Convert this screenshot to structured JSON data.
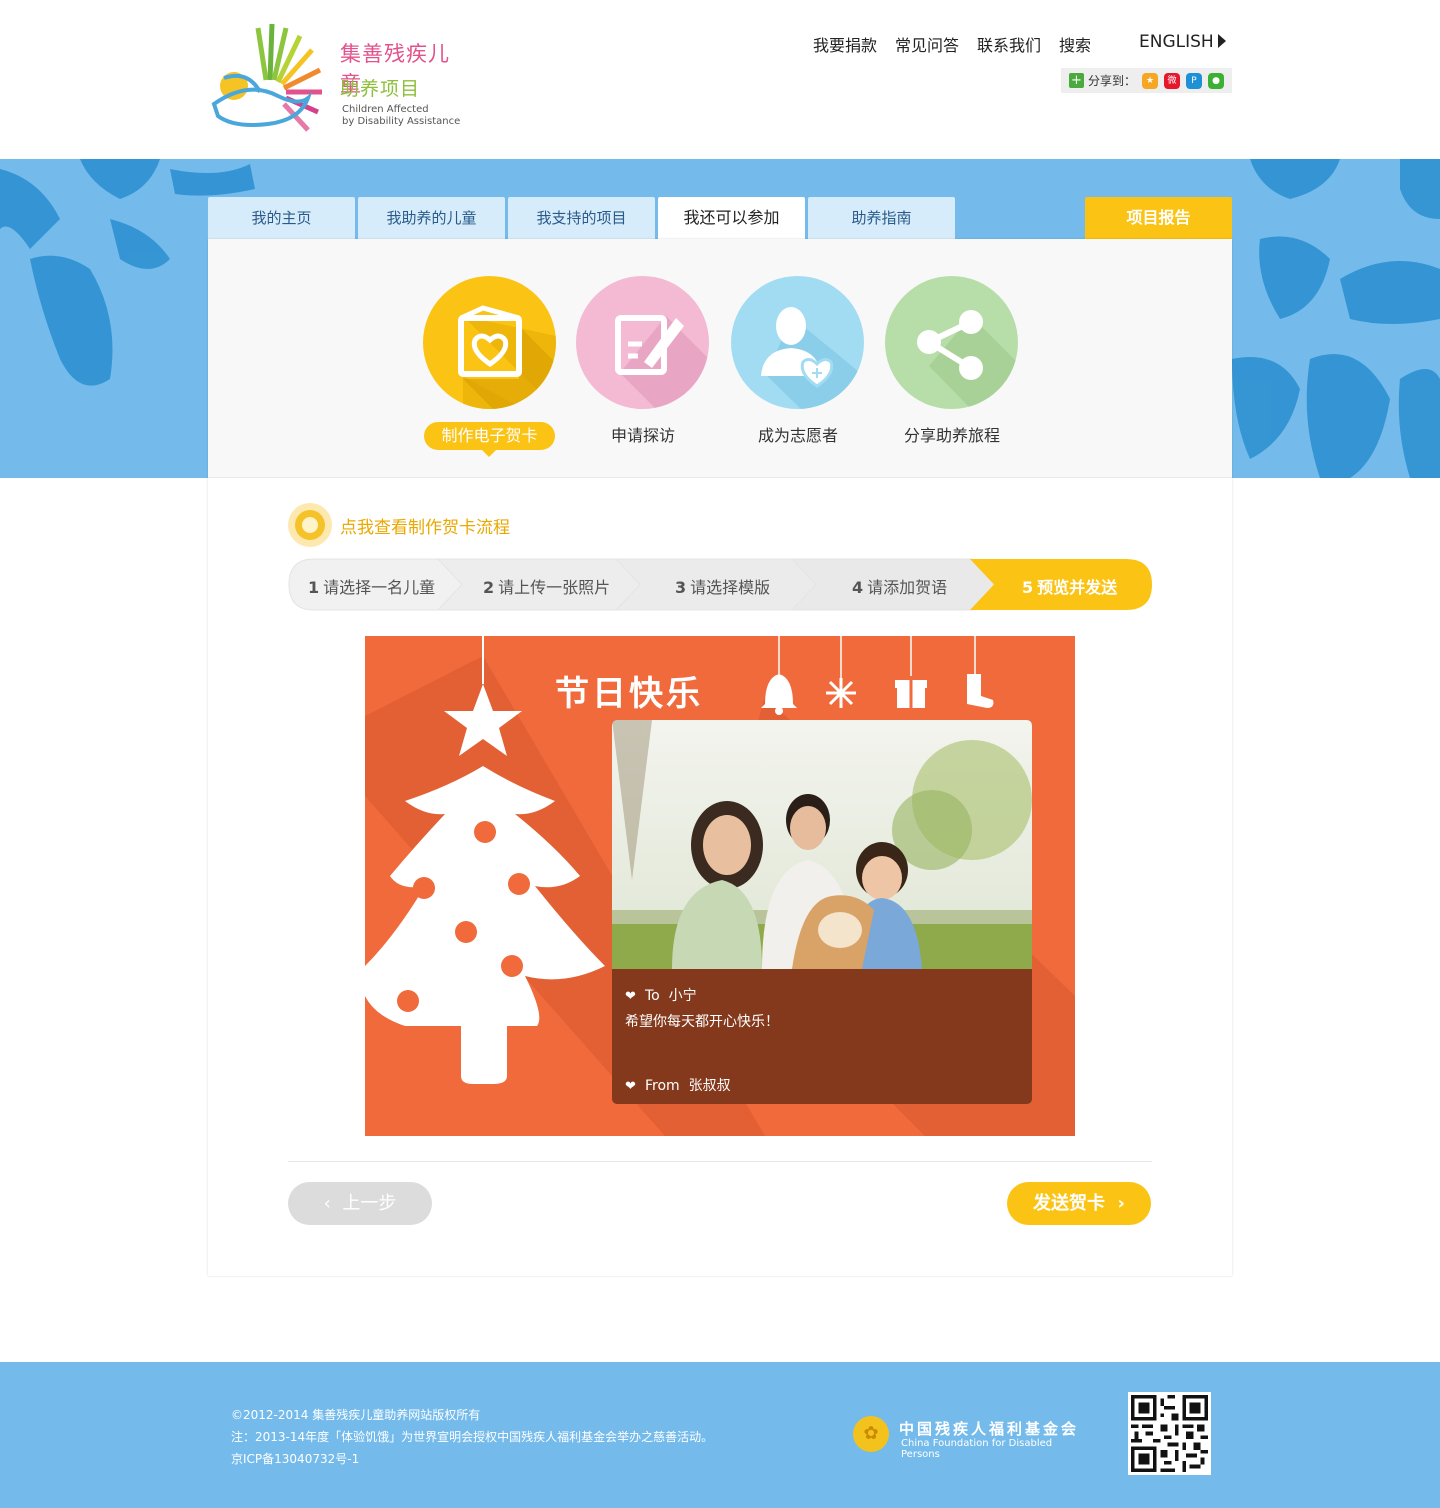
{
  "logo": {
    "title_line1": "集善残疾儿童",
    "title_line2": "助养项目",
    "subtitle_line1": "Children Affected",
    "subtitle_line2": "by Disability Assistance"
  },
  "topnav": {
    "items": [
      "我要捐款",
      "常见问答",
      "联系我们",
      "搜索"
    ],
    "english": "ENGLISH"
  },
  "share": {
    "label": "分享到："
  },
  "tabs": {
    "items": [
      "我的主页",
      "我助养的儿童",
      "我支持的项目",
      "我还可以参加",
      "助养指南"
    ],
    "active_index": 3,
    "report": "项目报告"
  },
  "actions": {
    "items": [
      {
        "label": "制作电子贺卡",
        "icon": "greeting-card-icon",
        "color": "#fbc314"
      },
      {
        "label": "申请探访",
        "icon": "edit-form-icon",
        "color": "#f4b9d3"
      },
      {
        "label": "成为志愿者",
        "icon": "volunteer-icon",
        "color": "#a2dcf3"
      },
      {
        "label": "分享助养旅程",
        "icon": "share-icon",
        "color": "#b7dea9"
      }
    ]
  },
  "flow_link": "点我查看制作贺卡流程",
  "steps": {
    "items": [
      {
        "num": "1",
        "label": "请选择一名儿童"
      },
      {
        "num": "2",
        "label": "请上传一张照片"
      },
      {
        "num": "3",
        "label": "请选择模版"
      },
      {
        "num": "4",
        "label": "请添加贺语"
      },
      {
        "num": "5",
        "label": "预览并发送"
      }
    ],
    "active_index": 4
  },
  "card": {
    "title": "节日快乐",
    "to_prefix": "To",
    "to_name": "小宁",
    "message": "希望你每天都开心快乐！",
    "from_prefix": "From",
    "from_name": "张叔叔"
  },
  "buttons": {
    "prev": "上一步",
    "send": "发送贺卡"
  },
  "footer": {
    "line1": "©2012-2014 集善残疾儿童助养网站版权所有",
    "line2": "注：2013-14年度「体验饥饿」为世界宣明会授权中国残疾人福利基金会举办之慈善活动。",
    "line3": "京ICP备13040732号-1",
    "foundation_cn": "中国残疾人福利基金会",
    "foundation_en": "China Foundation for Disabled Persons"
  },
  "colors": {
    "accent": "#fbc314",
    "banner": "#74bbec",
    "card_bg": "#f06a3c",
    "message_bg": "#84391d"
  }
}
